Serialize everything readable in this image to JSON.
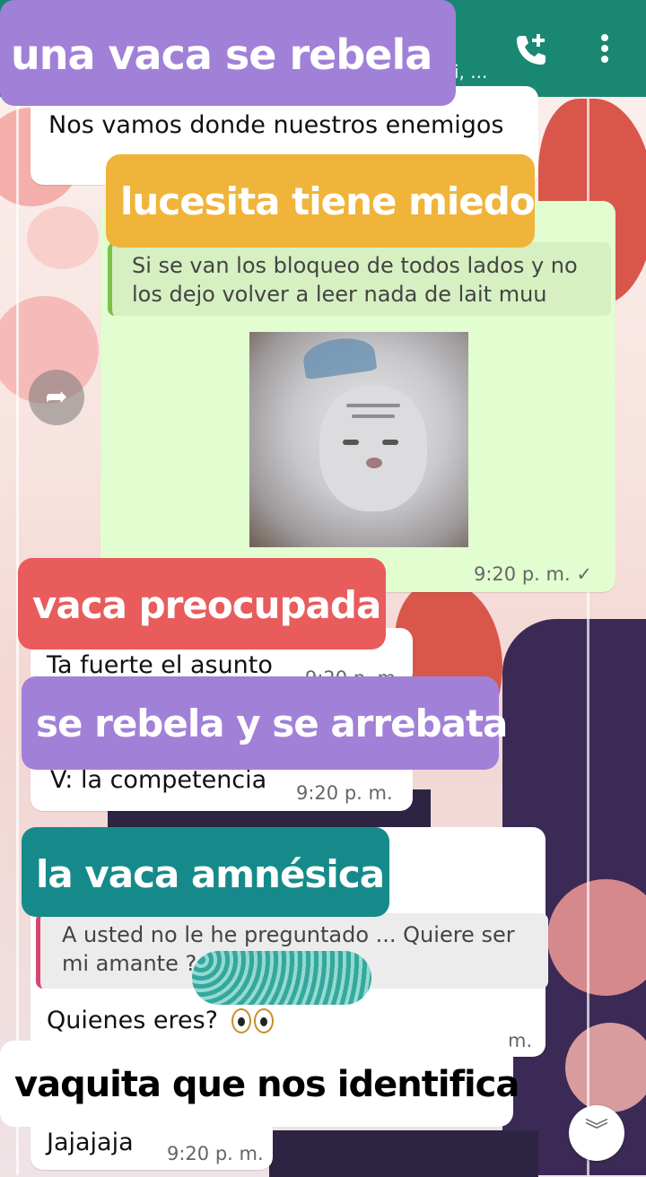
{
  "header": {
    "subtitle_fragment": "i, ...",
    "call_icon": "add-call-icon",
    "menu_icon": "more-vert-icon",
    "color": "#1a8773"
  },
  "labels": {
    "l1": "una vaca se rebela",
    "l2": "lucesita tiene miedo",
    "l3": "vaca preocupada",
    "l4": "se rebela y se arrebata",
    "l5": "la vaca amnésica",
    "l6": "vaquita que nos identifica"
  },
  "messages": {
    "m1_text": "Nos vamos donde nuestros enemigos",
    "m2_quote_line1": "Si se van los bloqueo de todos lados y no",
    "m2_quote_line2": "los dejo volver a leer nada de lait muu",
    "m2_time": "9:20 p. m. ✓",
    "m3_text": "Ta fuerte el asunto",
    "m3_time": "9:20 p. m.",
    "m4_text": "V: la competencia",
    "m4_time": "9:20 p. m.",
    "m5_quote_line1": "A usted no le he preguntado ... Quiere ser",
    "m5_quote_line2": "mi amante ?",
    "m5_text": "Quienes eres?",
    "m5_time": "m.",
    "m6_text": "Jajajaja",
    "m6_time": "9:20 p. m."
  },
  "icons": {
    "forward": "forward-icon",
    "scroll_down": "double-chevron-down-icon"
  }
}
